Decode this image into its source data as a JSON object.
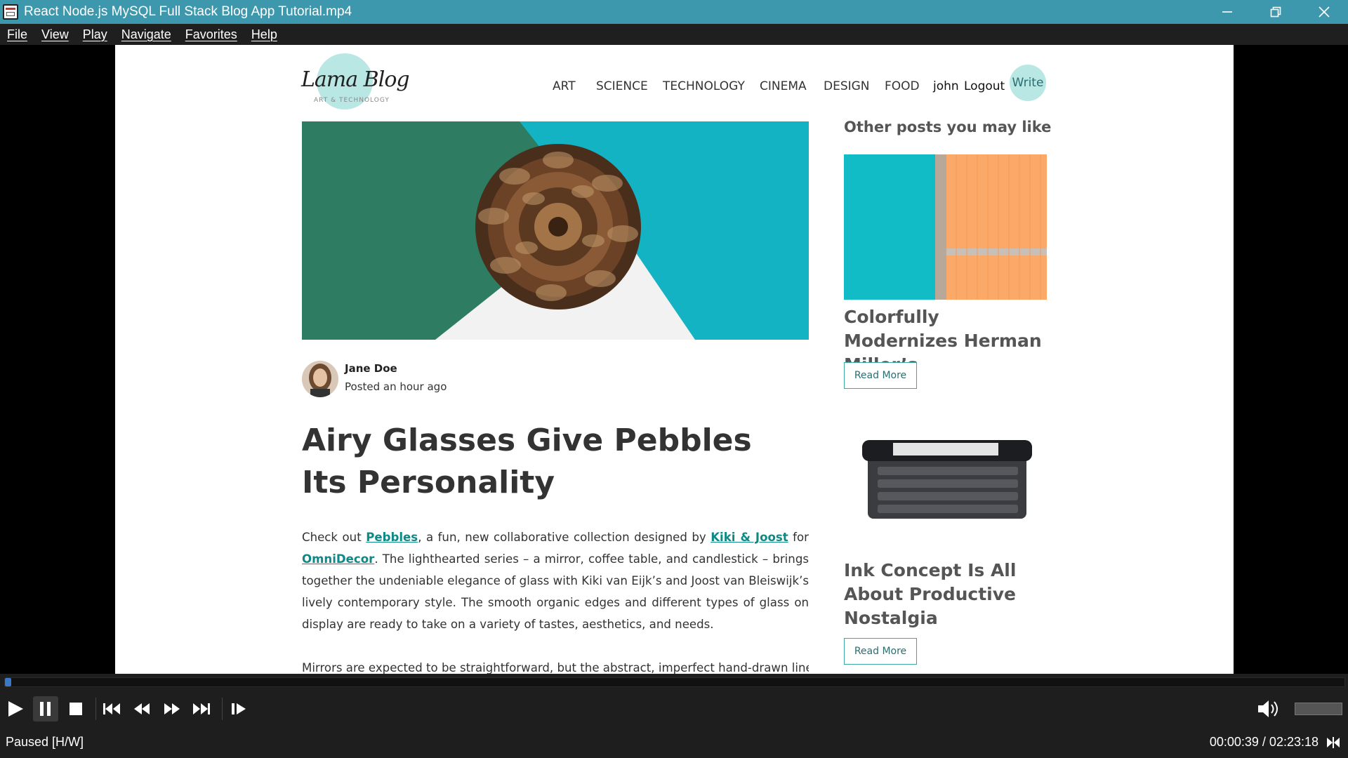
{
  "window": {
    "title": "React Node.js MySQL Full Stack Blog App Tutorial.mp4"
  },
  "menu": [
    "File",
    "View",
    "Play",
    "Navigate",
    "Favorites",
    "Help"
  ],
  "blog": {
    "logo_name": "Lama Blog",
    "logo_tagline": "ART & TECHNOLOGY",
    "nav": [
      "ART",
      "SCIENCE",
      "TECHNOLOGY",
      "CINEMA",
      "DESIGN",
      "FOOD"
    ],
    "user": "john",
    "logout": "Logout",
    "write": "Write",
    "author": {
      "name": "Jane Doe",
      "posted": "Posted an hour ago"
    },
    "post_title": "Airy Glasses Give Pebbles Its Personality",
    "body": {
      "p1_a": "Check out ",
      "link1": "Pebbles",
      "p1_b": ", a fun, new collaborative collection designed by ",
      "link2": "Kiki & Joost",
      "p1_c": " for ",
      "link3": "OmniDecor",
      "p1_d": ". The lighthearted series – a mirror, coffee table, and candlestick – brings together the undeniable elegance of glass with Kiki van Eijk’s and Joost van Bleiswijk’s lively contemporary style. The smooth organic edges and different types of glass on display are ready to take on a variety of tastes, aesthetics, and needs.",
      "p2": "Mirrors are expected to be straightforward, but the abstract, imperfect hand-drawn lines of"
    },
    "sidebar": {
      "heading": "Other posts you may like",
      "posts": [
        {
          "title": "Colorfully Modernizes Herman Miller’s",
          "read_more": "Read More"
        },
        {
          "title": "Ink Concept Is All About Productive Nostalgia",
          "read_more": "Read More"
        }
      ]
    }
  },
  "player": {
    "progress": 0.0046,
    "status": "Paused [H/W]",
    "time": "00:00:39 / 02:23:18",
    "volume": 0
  },
  "colors": {
    "titlebar": "#3e98ad",
    "accent": "#b9e7e4",
    "link": "#0d8a87"
  }
}
